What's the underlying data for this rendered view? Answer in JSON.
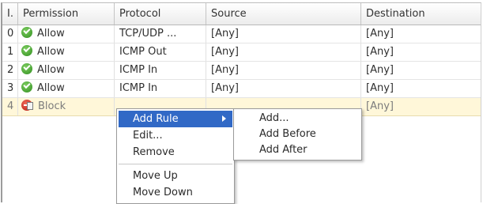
{
  "table": {
    "columns": [
      "I.",
      "Permission",
      "Protocol",
      "Source",
      "Destination"
    ],
    "rows": [
      {
        "index": "0",
        "permission": "Allow",
        "icon": "allow-icon",
        "protocol": "TCP/UDP ...",
        "source": "[Any]",
        "destination": "[Any]"
      },
      {
        "index": "1",
        "permission": "Allow",
        "icon": "allow-icon",
        "protocol": "ICMP Out",
        "source": "[Any]",
        "destination": "[Any]"
      },
      {
        "index": "2",
        "permission": "Allow",
        "icon": "allow-icon",
        "protocol": "ICMP In",
        "source": "[Any]",
        "destination": "[Any]"
      },
      {
        "index": "3",
        "permission": "Allow",
        "icon": "allow-icon",
        "protocol": "ICMP In",
        "source": "[Any]",
        "destination": "[Any]"
      },
      {
        "index": "4",
        "permission": "Block",
        "icon": "block-icon",
        "protocol": "",
        "source": "",
        "destination": "[Any]"
      }
    ]
  },
  "context_menu": {
    "items": [
      "Add Rule",
      "Edit...",
      "Remove",
      "Move Up",
      "Move Down"
    ],
    "active_item": "Add Rule"
  },
  "submenu": {
    "items": [
      "Add...",
      "Add Before",
      "Add After"
    ]
  },
  "colors": {
    "menu_highlight": "#3169c6",
    "selected_row": "#fff7d9",
    "allow_icon": "#3a9b28",
    "block_icon": "#c9271a"
  }
}
